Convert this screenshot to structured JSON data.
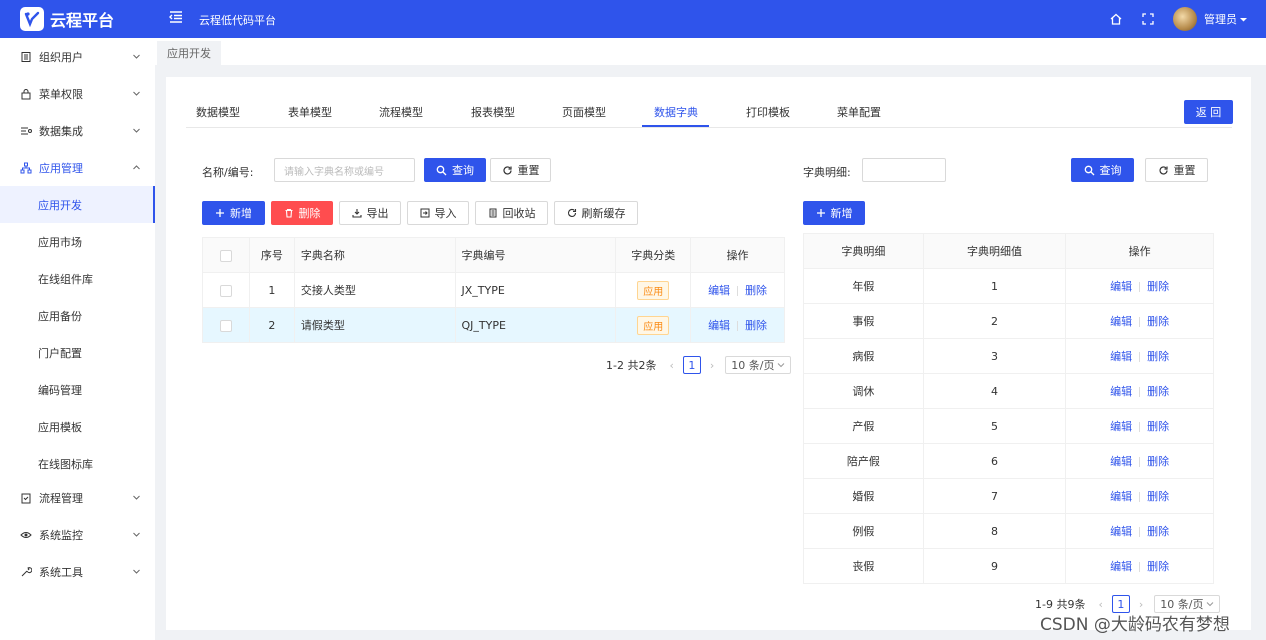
{
  "header": {
    "app_name": "云程平台",
    "title": "云程低代码平台",
    "user": "管理员"
  },
  "sidebar": {
    "groups": [
      {
        "label": "组织用户"
      },
      {
        "label": "菜单权限"
      },
      {
        "label": "数据集成"
      },
      {
        "label": "应用管理"
      },
      {
        "label": "流程管理"
      },
      {
        "label": "系统监控"
      },
      {
        "label": "系统工具"
      }
    ],
    "sub_items": [
      {
        "label": "应用开发"
      },
      {
        "label": "应用市场"
      },
      {
        "label": "在线组件库"
      },
      {
        "label": "应用备份"
      },
      {
        "label": "门户配置"
      },
      {
        "label": "编码管理"
      },
      {
        "label": "应用模板"
      },
      {
        "label": "在线图标库"
      }
    ]
  },
  "tabbar": {
    "active": "应用开发"
  },
  "module_tabs": [
    {
      "label": "数据模型"
    },
    {
      "label": "表单模型"
    },
    {
      "label": "流程模型"
    },
    {
      "label": "报表模型"
    },
    {
      "label": "页面模型"
    },
    {
      "label": "数据字典"
    },
    {
      "label": "打印模板"
    },
    {
      "label": "菜单配置"
    }
  ],
  "back_button": "返 回",
  "left": {
    "search_label": "名称/编号:",
    "search_placeholder": "请输入字典名称或编号",
    "query": "查询",
    "reset": "重置",
    "toolbar": {
      "add": "新增",
      "delete": "删除",
      "export": "导出",
      "import": "导入",
      "recycle": "回收站",
      "refresh": "刷新缓存"
    },
    "columns": [
      "序号",
      "字典名称",
      "字典编号",
      "字典分类",
      "操作"
    ],
    "rows": [
      {
        "index": "1",
        "name": "交接人类型",
        "code": "JX_TYPE",
        "category": "应用"
      },
      {
        "index": "2",
        "name": "请假类型",
        "code": "QJ_TYPE",
        "category": "应用"
      }
    ],
    "actions": {
      "edit": "编辑",
      "delete": "删除"
    },
    "pager": {
      "total": "1-2 共2条",
      "page": "1",
      "size": "10 条/页"
    }
  },
  "right": {
    "search_label": "字典明细:",
    "query": "查询",
    "reset": "重置",
    "add": "新增",
    "columns": [
      "字典明细",
      "字典明细值",
      "操作"
    ],
    "rows": [
      {
        "name": "年假",
        "value": "1"
      },
      {
        "name": "事假",
        "value": "2"
      },
      {
        "name": "病假",
        "value": "3"
      },
      {
        "name": "调休",
        "value": "4"
      },
      {
        "name": "产假",
        "value": "5"
      },
      {
        "name": "陪产假",
        "value": "6"
      },
      {
        "name": "婚假",
        "value": "7"
      },
      {
        "name": "例假",
        "value": "8"
      },
      {
        "name": "丧假",
        "value": "9"
      }
    ],
    "actions": {
      "edit": "编辑",
      "delete": "删除"
    },
    "pager": {
      "total": "1-9 共9条",
      "page": "1",
      "size": "10 条/页"
    }
  },
  "watermark": "CSDN @大龄码农有梦想",
  "colors": {
    "primary": "#2f54eb",
    "danger": "#ff4d4f",
    "tag": "#fa8c16"
  }
}
